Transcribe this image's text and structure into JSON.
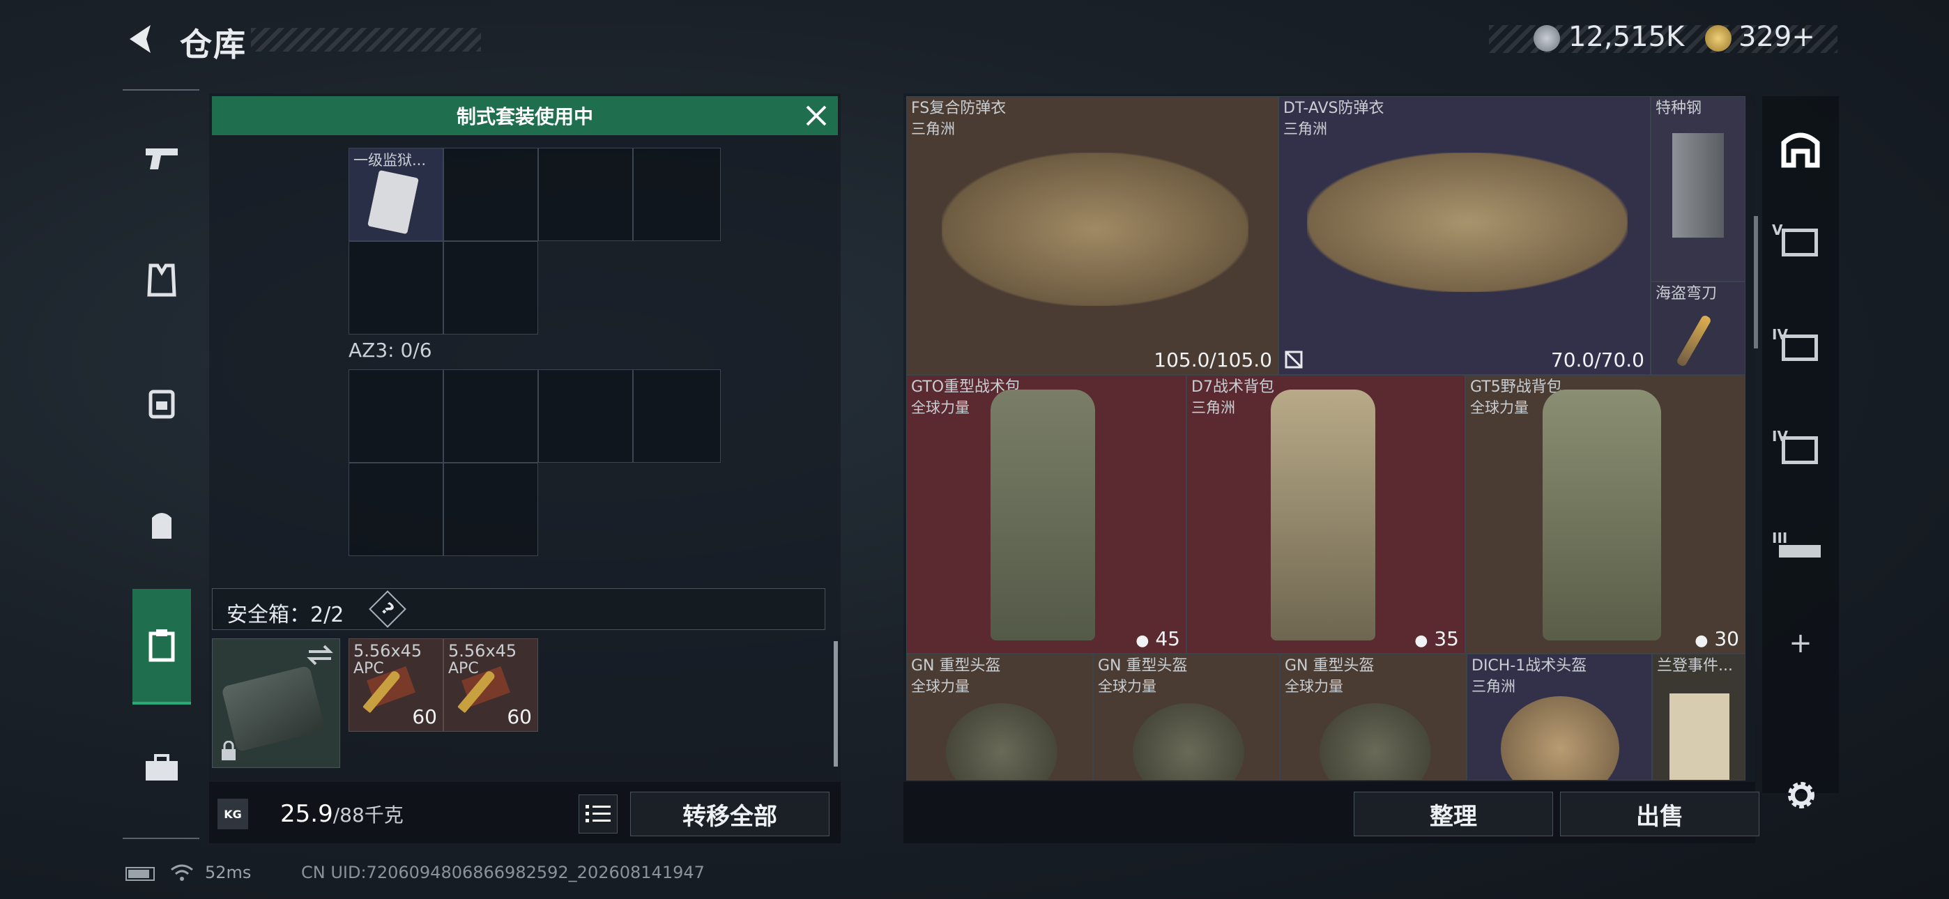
{
  "header": {
    "title": "仓库",
    "currency_silver": "12,515K",
    "currency_gold": "329+"
  },
  "banner": {
    "text": "制式套装使用中"
  },
  "loadout": {
    "item1_name": "一级监狱...",
    "az3_label": "AZ3: 0/6",
    "safebox_label": "安全箱：2/2",
    "help_glyph": "?",
    "ammo": [
      {
        "name": "5.56x45",
        "sub": "APC",
        "count": "60"
      },
      {
        "name": "5.56x45",
        "sub": "APC",
        "count": "60"
      }
    ]
  },
  "footer_left": {
    "weight_value": "25.9",
    "weight_max": "/88千克",
    "weight_unit_badge": "KG",
    "transfer_label": "转移全部"
  },
  "stash": {
    "items": [
      {
        "name": "FS复合防弹衣",
        "sub": "三角洲",
        "value": "105.0/105.0",
        "color": "#4a3c33"
      },
      {
        "name": "DT-AVS防弹衣",
        "sub": "三角洲",
        "value": "70.0/70.0",
        "color": "#33314a"
      },
      {
        "name": "特种钢",
        "sub": "",
        "value": "",
        "color": "#37354a"
      },
      {
        "name": "海盗弯刀",
        "sub": "",
        "value": "",
        "color": "#343247"
      },
      {
        "name": "GTO重型战术包",
        "sub": "全球力量",
        "value": "45",
        "color": "#5a2a30"
      },
      {
        "name": "D7战术背包",
        "sub": "三角洲",
        "value": "35",
        "color": "#5a2a30"
      },
      {
        "name": "GT5野战背包",
        "sub": "全球力量",
        "value": "30",
        "color": "#4a3c33"
      },
      {
        "name": "GN 重型头盔",
        "sub": "全球力量",
        "value": "",
        "color": "#4a3c33"
      },
      {
        "name": "GN 重型头盔",
        "sub": "全球力量",
        "value": "",
        "color": "#4a3c33"
      },
      {
        "name": "GN 重型头盔",
        "sub": "全球力量",
        "value": "",
        "color": "#4a3c33"
      },
      {
        "name": "DICH-1战术头盔",
        "sub": "三角洲",
        "value": "",
        "color": "#33314a"
      },
      {
        "name": "兰登事件...",
        "sub": "",
        "value": "",
        "color": "#3a3830"
      }
    ],
    "sort_label": "整理",
    "sell_label": "出售"
  },
  "right_rail": {
    "tabs": [
      "V",
      "IV",
      "IV",
      "III"
    ],
    "plus": "+"
  },
  "status": {
    "ping": "52ms",
    "uid": "CN UID:7206094806866982592_202608141947"
  },
  "colors": {
    "accent_green": "#1f6e4e",
    "rail_active": "#2aa876"
  }
}
